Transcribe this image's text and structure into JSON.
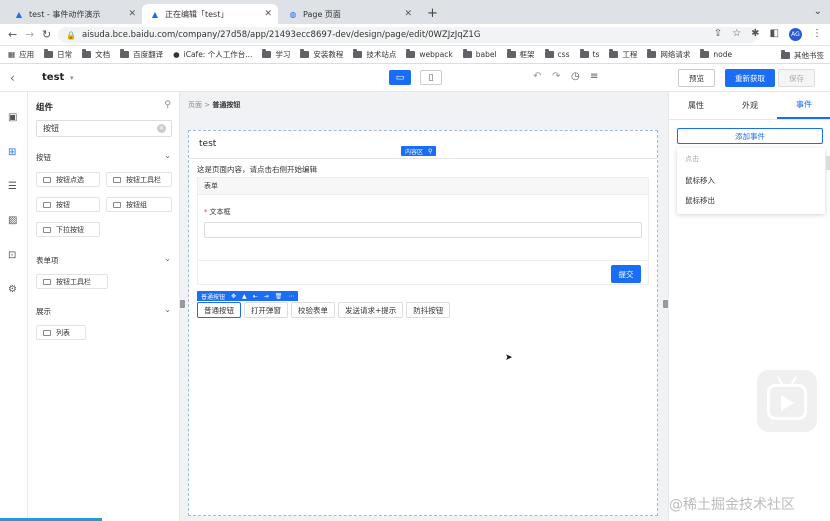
{
  "browser": {
    "tabs": [
      {
        "title": "test - 事件动作演示"
      },
      {
        "title": "正在编辑「test」"
      },
      {
        "title": "Page 页面"
      }
    ],
    "url": "aisuda.bce.baidu.com/company/27d58/app/21493ecc8697-dev/design/page/edit/0WZJzJqZ1G",
    "profile_initials": "AG",
    "bookmarks": [
      "应用",
      "日常",
      "文档",
      "百度翻译",
      "iCafe: 个人工作台...",
      "学习",
      "安装教程",
      "技术站点",
      "webpack",
      "babel",
      "框架",
      "css",
      "ts",
      "工程",
      "网络请求",
      "node"
    ],
    "other_bookmarks": "其他书签"
  },
  "app": {
    "title": "test",
    "buttons": {
      "preview": "预览",
      "refetch": "重新获取",
      "save": "保存"
    }
  },
  "component_panel": {
    "title": "组件",
    "search_value": "按钮",
    "sections": [
      {
        "name": "按钮",
        "items": [
          "按钮点选",
          "按钮工具栏",
          "按钮",
          "按钮组",
          "下拉按钮"
        ]
      },
      {
        "name": "表单项",
        "items": [
          "按钮工具栏"
        ]
      },
      {
        "name": "展示",
        "items": [
          "列表"
        ]
      }
    ]
  },
  "canvas": {
    "breadcrumb": {
      "root": "页面",
      "current": "普通按钮"
    },
    "page_title": "test",
    "content_tag": "内容区",
    "page_text": "这是页面内容，请点击右侧开始编辑",
    "form": {
      "header": "表单",
      "field_label": "文本框",
      "submit": "提交"
    },
    "selection_tag": "普通按钮",
    "buttons": [
      "普通按钮",
      "打开弹窗",
      "校验表单",
      "发送请求+提示",
      "防抖按钮"
    ]
  },
  "right_panel": {
    "tabs": [
      "属性",
      "外观",
      "事件"
    ],
    "active_tab": "事件",
    "add_event": "添加事件",
    "dropdown": {
      "header": "点击",
      "items": [
        "鼠标移入",
        "鼠标移出"
      ]
    }
  },
  "watermark": "@稀土掘金技术社区",
  "colors": {
    "accent": "#1a6ef5"
  }
}
